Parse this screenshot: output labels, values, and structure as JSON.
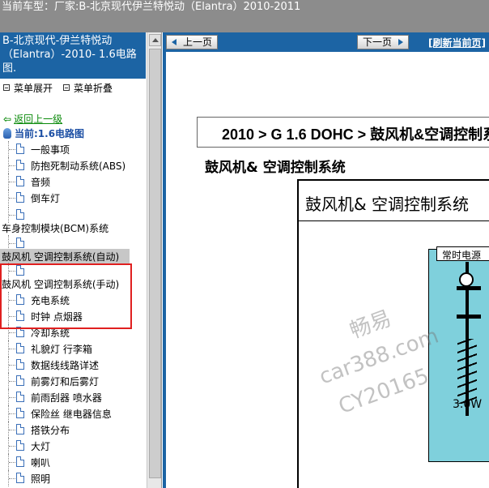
{
  "header": {
    "label": "当前车型：",
    "model": "厂家:B-北京现代伊兰特悦动（Elantra）2010-2011"
  },
  "left": {
    "title": "B-北京现代-伊兰特悦动（Elantra）-2010- 1.6电路图.",
    "expand_label": "菜单展开",
    "collapse_label": "菜单折叠",
    "back_label": "返回上一级",
    "current_label": "当前:1.6电路图",
    "items": [
      "一般事项",
      "防抱死制动系统(ABS)",
      "音频",
      "倒车灯",
      "车身控制模块(BCM)系统",
      "鼓风机 空调控制系统(自动)",
      "鼓风机 空调控制系统(手动)",
      "充电系统",
      "时钟 点烟器",
      "冷却系统",
      "礼貌灯 行李箱",
      "数据线线路详述",
      "前雾灯和后雾灯",
      "前雨刮器 喷水器",
      "保险丝 继电器信息",
      "搭铁分布",
      "大灯",
      "喇叭",
      "照明"
    ]
  },
  "nav": {
    "prev_label": "上一页",
    "next_label": "下一页",
    "refresh_label": "[刷新当前页]"
  },
  "doc": {
    "breadcrumb": "2010 > G 1.6 DOHC > 鼓风机&空调控制系统",
    "subtitle": "鼓风机& 空调控制系统",
    "diagram_title": "鼓风机&  空调控制系统",
    "power_label": "常时电源",
    "watt_label": "3.0W"
  },
  "watermark": {
    "line1": "畅易",
    "line2": "car388.com",
    "line3": "CY20165"
  },
  "colors": {
    "accent": "#1c64a4",
    "highlight_box": "#e02020",
    "panel_fill": "#7fd0dc",
    "topbar": "#8c8c8c"
  }
}
